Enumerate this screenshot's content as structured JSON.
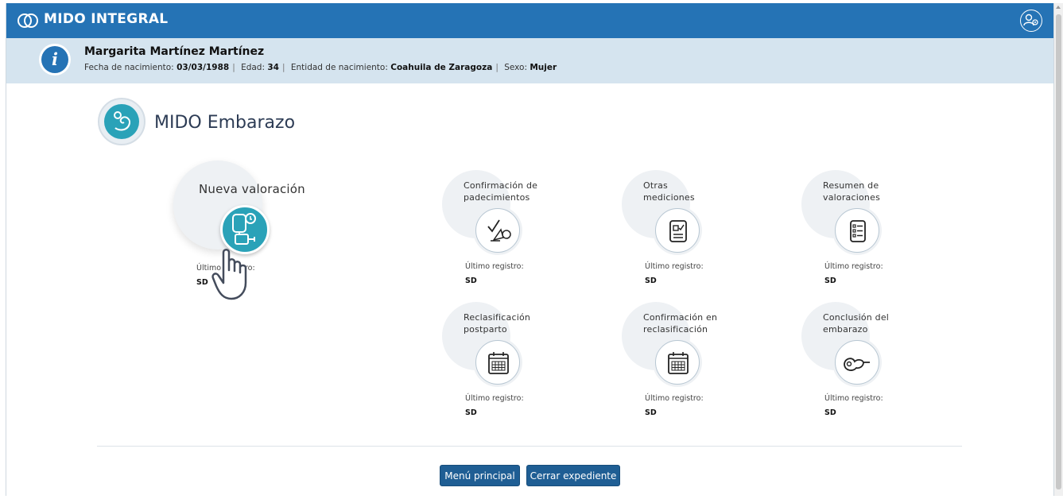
{
  "app": {
    "title": "MIDO INTEGRAL",
    "logo_icon": "infinity-logo-icon",
    "user_icon": "user-settings-icon"
  },
  "patient": {
    "name": "Margarita Martínez Martínez",
    "birth_label": "Fecha de nacimiento:",
    "birth_value": "03/03/1988",
    "age_label": "Edad:",
    "age_value": "34",
    "entity_label": "Entidad de nacimiento:",
    "entity_value": "Coahuila de Zaragoza",
    "sex_label": "Sexo:",
    "sex_value": "Mujer",
    "info_icon": "info-icon"
  },
  "section": {
    "title": "MIDO Embarazo",
    "icon": "pregnancy-icon"
  },
  "tiles": [
    {
      "label": "Nueva valoración",
      "record_label": "Último registro:",
      "record_value": "SD",
      "icon": "blood-pressure-icon"
    },
    {
      "label": "Confirmación de padecimientos",
      "record_label": "Último registro:",
      "record_value": "SD",
      "icon": "checkmark-stethoscope-icon"
    },
    {
      "label": "Otras mediciones",
      "record_label": "Último registro:",
      "record_value": "SD",
      "icon": "checklist-icon"
    },
    {
      "label": "Resumen de valoraciones",
      "record_label": "Último registro:",
      "record_value": "SD",
      "icon": "list-icon"
    },
    {
      "label": "Reclasificación postparto",
      "record_label": "Último registro:",
      "record_value": "SD",
      "icon": "calendar-icon"
    },
    {
      "label": "Confirmación en reclasificación",
      "record_label": "Último registro:",
      "record_value": "SD",
      "icon": "calendar-icon"
    },
    {
      "label": "Conclusión del embarazo",
      "record_label": "Último registro:",
      "record_value": "SD",
      "icon": "newborn-icon"
    }
  ],
  "buttons": {
    "main_menu": "Menú principal",
    "close_record": "Cerrar expediente"
  },
  "colors": {
    "header": "#2573b5",
    "banner": "#d5e4ef",
    "accent": "#2aa2b8",
    "button": "#1f5e94"
  }
}
